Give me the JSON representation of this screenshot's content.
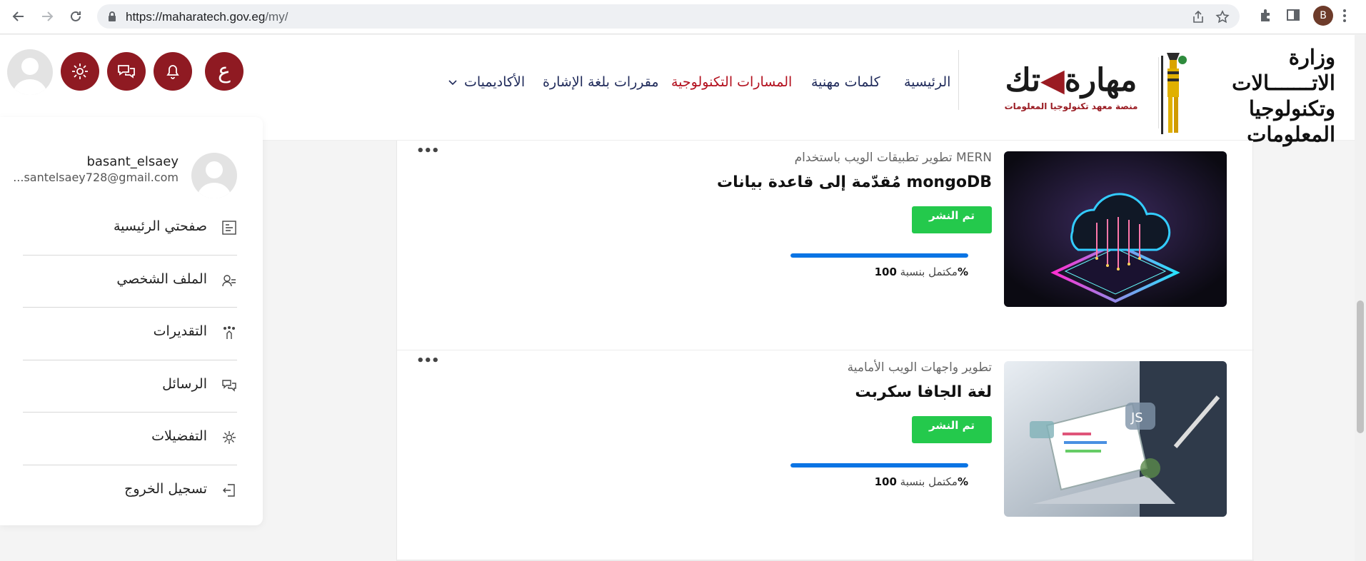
{
  "browser": {
    "url_host": "https://maharatech.gov.eg",
    "url_path": "/my/",
    "profile_initial": "B"
  },
  "header": {
    "ministry_line1": "وزارة الاتـــــــالات",
    "ministry_line2": "وتكنولوجيا المعلومات",
    "mahara_title": "مهارة",
    "mahara_title_suffix": "تك",
    "mahara_subtitle": "منصة معهد تكنولوجيا المعلومات",
    "nav": [
      {
        "label": "الرئيسية",
        "active": false
      },
      {
        "label": "كلمات مهنية",
        "active": false
      },
      {
        "label": "المسارات التكنولوجية",
        "active": true
      },
      {
        "label": "مقررات بلغة الإشارة",
        "active": false
      },
      {
        "label": "الأكاديميات",
        "active": false
      }
    ],
    "language_button": "ع"
  },
  "courses": [
    {
      "category": "تطوير تطبيقات الويب باستخدام MERN",
      "title": "مُقدّمة إلى قاعدة بيانات mongoDB",
      "status": "تم النشر",
      "progress_label": "مكتمل بنسبة",
      "progress_value": "100%",
      "progress": 1.0
    },
    {
      "category": "تطوير واجهات الويب الأمامية",
      "title": "لغة الجافا سكربت",
      "status": "تم النشر",
      "progress_label": "مكتمل بنسبة",
      "progress_value": "100%",
      "progress": 1.0
    }
  ],
  "more_label": "•••",
  "user_menu": {
    "username": "basant_elsaey",
    "email": "...santelsaey728@gmail.com",
    "items": [
      {
        "label": "صفحتي الرئيسية",
        "icon": "dashboard-icon"
      },
      {
        "label": "الملف الشخصي",
        "icon": "profile-icon"
      },
      {
        "label": "التقديرات",
        "icon": "grades-icon"
      },
      {
        "label": "الرسائل",
        "icon": "messages-icon"
      },
      {
        "label": "التفضيلات",
        "icon": "preferences-icon"
      },
      {
        "label": "تسجيل الخروج",
        "icon": "logout-icon"
      }
    ]
  },
  "colors": {
    "brand_red": "#8f1a22",
    "active_nav": "#b3101e",
    "nav_text": "#1f2a5a",
    "status_green": "#24c94c",
    "progress_blue": "#0a74e4"
  }
}
